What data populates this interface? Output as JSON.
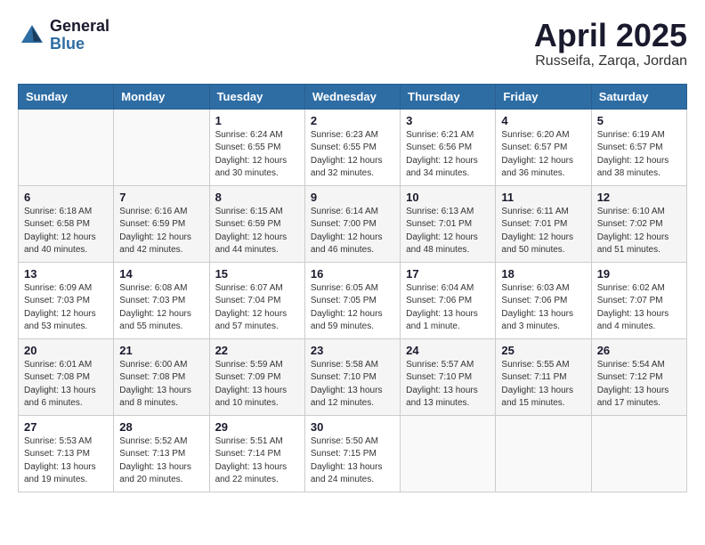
{
  "logo": {
    "general": "General",
    "blue": "Blue"
  },
  "title": "April 2025",
  "subtitle": "Russeifa, Zarqa, Jordan",
  "headers": [
    "Sunday",
    "Monday",
    "Tuesday",
    "Wednesday",
    "Thursday",
    "Friday",
    "Saturday"
  ],
  "weeks": [
    [
      {
        "day": "",
        "info": ""
      },
      {
        "day": "",
        "info": ""
      },
      {
        "day": "1",
        "info": "Sunrise: 6:24 AM\nSunset: 6:55 PM\nDaylight: 12 hours and 30 minutes."
      },
      {
        "day": "2",
        "info": "Sunrise: 6:23 AM\nSunset: 6:55 PM\nDaylight: 12 hours and 32 minutes."
      },
      {
        "day": "3",
        "info": "Sunrise: 6:21 AM\nSunset: 6:56 PM\nDaylight: 12 hours and 34 minutes."
      },
      {
        "day": "4",
        "info": "Sunrise: 6:20 AM\nSunset: 6:57 PM\nDaylight: 12 hours and 36 minutes."
      },
      {
        "day": "5",
        "info": "Sunrise: 6:19 AM\nSunset: 6:57 PM\nDaylight: 12 hours and 38 minutes."
      }
    ],
    [
      {
        "day": "6",
        "info": "Sunrise: 6:18 AM\nSunset: 6:58 PM\nDaylight: 12 hours and 40 minutes."
      },
      {
        "day": "7",
        "info": "Sunrise: 6:16 AM\nSunset: 6:59 PM\nDaylight: 12 hours and 42 minutes."
      },
      {
        "day": "8",
        "info": "Sunrise: 6:15 AM\nSunset: 6:59 PM\nDaylight: 12 hours and 44 minutes."
      },
      {
        "day": "9",
        "info": "Sunrise: 6:14 AM\nSunset: 7:00 PM\nDaylight: 12 hours and 46 minutes."
      },
      {
        "day": "10",
        "info": "Sunrise: 6:13 AM\nSunset: 7:01 PM\nDaylight: 12 hours and 48 minutes."
      },
      {
        "day": "11",
        "info": "Sunrise: 6:11 AM\nSunset: 7:01 PM\nDaylight: 12 hours and 50 minutes."
      },
      {
        "day": "12",
        "info": "Sunrise: 6:10 AM\nSunset: 7:02 PM\nDaylight: 12 hours and 51 minutes."
      }
    ],
    [
      {
        "day": "13",
        "info": "Sunrise: 6:09 AM\nSunset: 7:03 PM\nDaylight: 12 hours and 53 minutes."
      },
      {
        "day": "14",
        "info": "Sunrise: 6:08 AM\nSunset: 7:03 PM\nDaylight: 12 hours and 55 minutes."
      },
      {
        "day": "15",
        "info": "Sunrise: 6:07 AM\nSunset: 7:04 PM\nDaylight: 12 hours and 57 minutes."
      },
      {
        "day": "16",
        "info": "Sunrise: 6:05 AM\nSunset: 7:05 PM\nDaylight: 12 hours and 59 minutes."
      },
      {
        "day": "17",
        "info": "Sunrise: 6:04 AM\nSunset: 7:06 PM\nDaylight: 13 hours and 1 minute."
      },
      {
        "day": "18",
        "info": "Sunrise: 6:03 AM\nSunset: 7:06 PM\nDaylight: 13 hours and 3 minutes."
      },
      {
        "day": "19",
        "info": "Sunrise: 6:02 AM\nSunset: 7:07 PM\nDaylight: 13 hours and 4 minutes."
      }
    ],
    [
      {
        "day": "20",
        "info": "Sunrise: 6:01 AM\nSunset: 7:08 PM\nDaylight: 13 hours and 6 minutes."
      },
      {
        "day": "21",
        "info": "Sunrise: 6:00 AM\nSunset: 7:08 PM\nDaylight: 13 hours and 8 minutes."
      },
      {
        "day": "22",
        "info": "Sunrise: 5:59 AM\nSunset: 7:09 PM\nDaylight: 13 hours and 10 minutes."
      },
      {
        "day": "23",
        "info": "Sunrise: 5:58 AM\nSunset: 7:10 PM\nDaylight: 13 hours and 12 minutes."
      },
      {
        "day": "24",
        "info": "Sunrise: 5:57 AM\nSunset: 7:10 PM\nDaylight: 13 hours and 13 minutes."
      },
      {
        "day": "25",
        "info": "Sunrise: 5:55 AM\nSunset: 7:11 PM\nDaylight: 13 hours and 15 minutes."
      },
      {
        "day": "26",
        "info": "Sunrise: 5:54 AM\nSunset: 7:12 PM\nDaylight: 13 hours and 17 minutes."
      }
    ],
    [
      {
        "day": "27",
        "info": "Sunrise: 5:53 AM\nSunset: 7:13 PM\nDaylight: 13 hours and 19 minutes."
      },
      {
        "day": "28",
        "info": "Sunrise: 5:52 AM\nSunset: 7:13 PM\nDaylight: 13 hours and 20 minutes."
      },
      {
        "day": "29",
        "info": "Sunrise: 5:51 AM\nSunset: 7:14 PM\nDaylight: 13 hours and 22 minutes."
      },
      {
        "day": "30",
        "info": "Sunrise: 5:50 AM\nSunset: 7:15 PM\nDaylight: 13 hours and 24 minutes."
      },
      {
        "day": "",
        "info": ""
      },
      {
        "day": "",
        "info": ""
      },
      {
        "day": "",
        "info": ""
      }
    ]
  ]
}
